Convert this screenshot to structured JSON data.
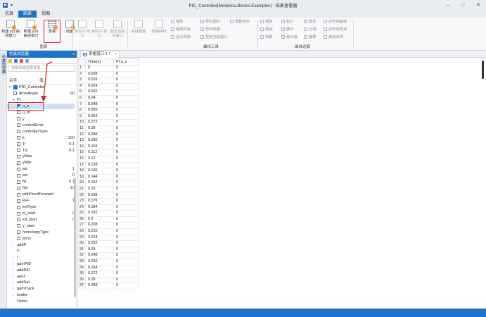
{
  "window": {
    "title": "PID_Controller[Modelica.Blocks.Examples] - 结果查看器",
    "quick_access": "▾",
    "controls": [
      "–",
      "□",
      "✕"
    ]
  },
  "ribbon_tabs": [
    {
      "label": "仿真",
      "active": false
    },
    {
      "label": "图表",
      "active": true
    },
    {
      "label": "视图",
      "active": false
    }
  ],
  "ribbon": {
    "group_chart": {
      "label": "图表",
      "buttons": [
        {
          "label": "新建 y(t) 曲线窗口"
        },
        {
          "label": "新建 y(x) 曲线窗口"
        },
        {
          "label": "表格"
        },
        {
          "label": "动画"
        }
      ]
    },
    "group_window": {
      "buttons": [
        {
          "label": "添加子 窗口"
        },
        {
          "label": "移除子 窗口"
        },
        {
          "label": "固定当前 子窗口"
        }
      ]
    },
    "group_curve_tools": {
      "label": "曲线工具",
      "big": [
        {
          "label": "曲线赋值"
        },
        {
          "label": "包络曲线"
        }
      ],
      "small": [
        [
          "缩放",
          "缩放所有",
          "显示网格"
        ],
        [
          "导出图片",
          "导出结果",
          "复制当前图片"
        ],
        [
          "调整坐标",
          ""
        ]
      ]
    },
    "group_curve_ops": {
      "label": "曲线运算",
      "small": [
        [
          "相加",
          "相减",
          "相乘"
        ],
        [
          "积分",
          "微分",
          "绝对值"
        ],
        [
          "取反",
          "比例",
          "偏移"
        ],
        [
          "对齐到基线",
          "对齐到零点",
          "曲线采样"
        ]
      ]
    }
  },
  "left_strip": {
    "label": "仿真浏览器"
  },
  "browser": {
    "title": "仿真浏览器",
    "close": "×",
    "search_placeholder": "搜索仿真结果变量",
    "col_name": "名字",
    "col_value": "值",
    "tree": [
      {
        "name": "PID_Controller",
        "value": "",
        "type": "model"
      },
      {
        "name": "driveAngle",
        "value": "90",
        "type": "leaf",
        "indent": 1
      },
      {
        "name": "PI",
        "value": "",
        "type": "group",
        "indent": 1
      },
      {
        "name": "u_s",
        "value": "",
        "type": "leaf",
        "indent": 2,
        "checked": true,
        "selected": true
      },
      {
        "name": "u_m",
        "value": "",
        "type": "leaf",
        "indent": 2
      },
      {
        "name": "y",
        "value": "",
        "type": "leaf",
        "indent": 2
      },
      {
        "name": "controlError",
        "value": "",
        "type": "leaf",
        "indent": 2
      },
      {
        "name": "controllerType",
        "value": "",
        "type": "leaf",
        "indent": 2
      },
      {
        "name": "k",
        "value": "100",
        "type": "leaf",
        "indent": 2
      },
      {
        "name": "Ti",
        "value": "0.1",
        "type": "leaf",
        "indent": 2
      },
      {
        "name": "Td",
        "value": "0.1",
        "type": "leaf",
        "indent": 2
      },
      {
        "name": "yMax",
        "value": "",
        "type": "leaf",
        "indent": 2
      },
      {
        "name": "yMin",
        "value": "",
        "type": "leaf",
        "indent": 2
      },
      {
        "name": "wp",
        "value": "1",
        "type": "leaf",
        "indent": 2
      },
      {
        "name": "wd",
        "value": "0",
        "type": "leaf",
        "indent": 2
      },
      {
        "name": "Ni",
        "value": "0.1",
        "type": "leaf",
        "indent": 2
      },
      {
        "name": "Nd",
        "value": "10",
        "type": "leaf",
        "indent": 2
      },
      {
        "name": "withFeedForward",
        "value": "",
        "type": "leaf",
        "indent": 2
      },
      {
        "name": "kFF",
        "value": "1",
        "type": "leaf",
        "indent": 2
      },
      {
        "name": "initType",
        "value": "",
        "type": "leaf",
        "indent": 2
      },
      {
        "name": "xi_start",
        "value": "0",
        "type": "leaf",
        "indent": 2
      },
      {
        "name": "xd_start",
        "value": "0",
        "type": "leaf",
        "indent": 2
      },
      {
        "name": "y_start",
        "value": "",
        "type": "leaf",
        "indent": 2
      },
      {
        "name": "homotopyType",
        "value": "",
        "type": "leaf",
        "indent": 2
      },
      {
        "name": "strict",
        "value": "",
        "type": "leaf",
        "indent": 2
      },
      {
        "name": "addP",
        "value": "",
        "type": "collapsed",
        "indent": 1
      },
      {
        "name": "P",
        "value": "",
        "type": "collapsed",
        "indent": 1
      },
      {
        "name": "I",
        "value": "",
        "type": "collapsed",
        "indent": 1
      },
      {
        "name": "gainPID",
        "value": "",
        "type": "collapsed",
        "indent": 1
      },
      {
        "name": "addPID",
        "value": "",
        "type": "collapsed",
        "indent": 1
      },
      {
        "name": "addI",
        "value": "",
        "type": "collapsed",
        "indent": 1
      },
      {
        "name": "addSat",
        "value": "",
        "type": "collapsed",
        "indent": 1
      },
      {
        "name": "gainTrack",
        "value": "",
        "type": "collapsed",
        "indent": 1
      },
      {
        "name": "limiter",
        "value": "",
        "type": "collapsed",
        "indent": 1
      },
      {
        "name": "Dzero",
        "value": "",
        "type": "collapsed",
        "indent": 1
      }
    ]
  },
  "doc_tab": {
    "label": "表格窗口-1 *",
    "close": "×"
  },
  "table": {
    "headers": [
      "",
      "Time(s)",
      "PI.u_s"
    ],
    "rows": [
      [
        "1",
        "0",
        "0"
      ],
      [
        "2",
        "0.008",
        "0"
      ],
      [
        "3",
        "0.016",
        "0"
      ],
      [
        "4",
        "0.024",
        "0"
      ],
      [
        "5",
        "0.032",
        "0"
      ],
      [
        "6",
        "0.04",
        "0"
      ],
      [
        "7",
        "0.048",
        "0"
      ],
      [
        "8",
        "0.056",
        "0"
      ],
      [
        "9",
        "0.064",
        "0"
      ],
      [
        "10",
        "0.072",
        "0"
      ],
      [
        "11",
        "0.08",
        "0"
      ],
      [
        "12",
        "0.088",
        "0"
      ],
      [
        "13",
        "0.096",
        "0"
      ],
      [
        "14",
        "0.104",
        "0"
      ],
      [
        "15",
        "0.112",
        "0"
      ],
      [
        "16",
        "0.12",
        "0"
      ],
      [
        "17",
        "0.128",
        "0"
      ],
      [
        "18",
        "0.136",
        "0"
      ],
      [
        "19",
        "0.144",
        "0"
      ],
      [
        "20",
        "0.152",
        "0"
      ],
      [
        "21",
        "0.16",
        "0"
      ],
      [
        "22",
        "0.168",
        "0"
      ],
      [
        "23",
        "0.176",
        "0"
      ],
      [
        "24",
        "0.184",
        "0"
      ],
      [
        "25",
        "0.192",
        "0"
      ],
      [
        "26",
        "0.2",
        "0"
      ],
      [
        "27",
        "0.208",
        "0"
      ],
      [
        "28",
        "0.216",
        "0"
      ],
      [
        "29",
        "0.224",
        "0"
      ],
      [
        "30",
        "0.232",
        "0"
      ],
      [
        "31",
        "0.24",
        "0"
      ],
      [
        "32",
        "0.248",
        "0"
      ],
      [
        "33",
        "0.256",
        "0"
      ],
      [
        "34",
        "0.264",
        "0"
      ],
      [
        "35",
        "0.272",
        "0"
      ],
      [
        "36",
        "0.28",
        "0"
      ],
      [
        "37",
        "0.288",
        "0"
      ]
    ]
  },
  "colors": {
    "accent": "#1f73c9",
    "annotation": "#e3232a"
  }
}
